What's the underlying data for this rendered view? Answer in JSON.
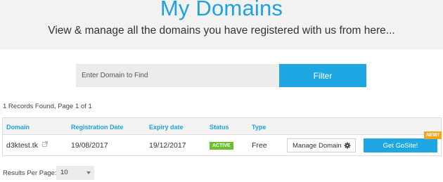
{
  "header": {
    "title": "My Domains",
    "subtitle": "View & manage all the domains you have registered with us from here..."
  },
  "search": {
    "placeholder": "Enter Domain to Find",
    "filter_label": "Filter"
  },
  "records_info": "1 Records Found, Page 1 of 1",
  "table": {
    "columns": [
      "Domain",
      "Registration Date",
      "Expiry date",
      "Status",
      "Type"
    ],
    "rows": [
      {
        "domain": "d3ktest.tk",
        "registration_date": "19/08/2017",
        "expiry_date": "19/12/2017",
        "status": "ACTIVE",
        "type": "Free",
        "manage_label": "Manage Domain",
        "gosite_label": "Get GoSite!",
        "new_badge": "NEW!"
      }
    ]
  },
  "pagination": {
    "per_page_label": "Results Per Page:",
    "per_page_value": "10"
  },
  "colors": {
    "accent": "#1ea3dc",
    "status_active": "#6cc12b",
    "new_badge": "#f7a31b"
  }
}
